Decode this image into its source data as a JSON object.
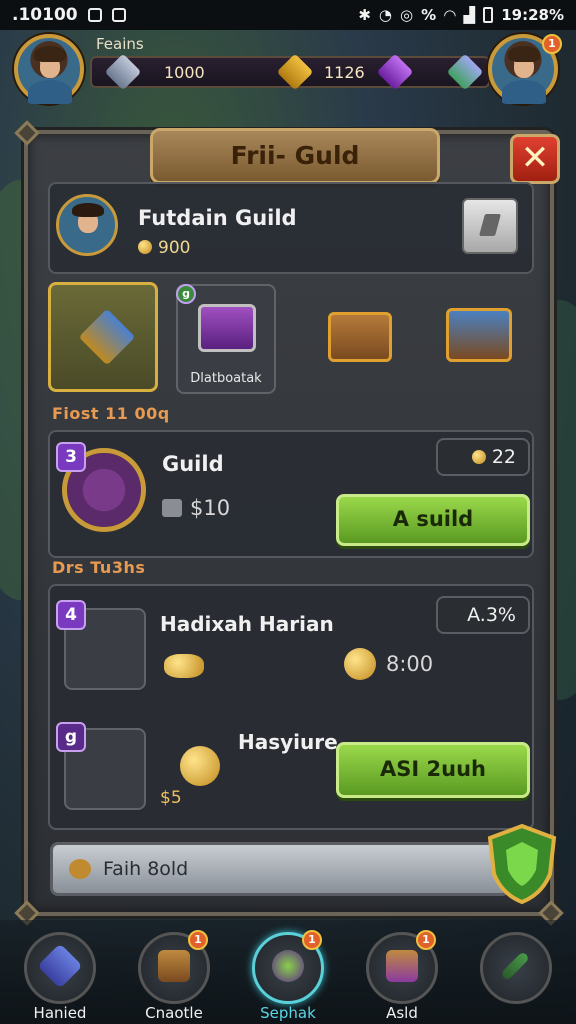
{
  "status_bar": {
    "time": ".10100",
    "right_text": "19:28%",
    "percent": "%"
  },
  "top_bar": {
    "player_name": "Feains",
    "currency_1": "1000",
    "currency_2": "1126",
    "notif_right": "1"
  },
  "panel": {
    "title": "Frii- Guld",
    "close_label": "✕",
    "guild": {
      "name": "Futdain Guild",
      "gold": "900"
    },
    "items": [
      {
        "label": "",
        "selected": true
      },
      {
        "label": "Dlatboatak",
        "selected": false,
        "badge": "g"
      },
      {
        "label": "",
        "selected": false
      },
      {
        "label": "",
        "selected": false
      }
    ],
    "section_1_heading": "Fiost 11 00q",
    "guild_row": {
      "level": "3",
      "title": "Guild",
      "cost": "$10",
      "tag_value": "22",
      "button_label": "A suild"
    },
    "section_2_heading": "Drs Tu3hs",
    "quests": [
      {
        "level": "4",
        "title": "Hadixah Harian",
        "tag": "A.3%",
        "reward": "8:00"
      },
      {
        "level": "g",
        "title": "Hasyiure",
        "reward": "$5",
        "button_label": "ASI 2uuh"
      }
    ],
    "search_placeholder": "Faih 8old"
  },
  "bottom_nav": [
    {
      "label": "Hanied",
      "badge": "",
      "active": false
    },
    {
      "label": "Cnaotle",
      "badge": "1",
      "active": false
    },
    {
      "label": "Sephak",
      "badge": "1",
      "active": true
    },
    {
      "label": "Asld",
      "badge": "1",
      "active": false
    },
    {
      "label": "",
      "badge": "",
      "active": false
    }
  ],
  "colors": {
    "accent_gold": "#c99a3a",
    "button_green": "#7bc23a",
    "close_red": "#d43a28",
    "active_cyan": "#5ad8e8"
  }
}
